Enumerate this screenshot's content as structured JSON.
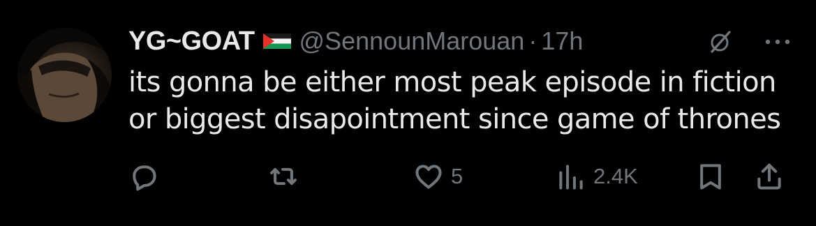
{
  "tweet": {
    "display_name": "YG~GOAT",
    "flag_icon": "palestine-flag-icon",
    "handle": "@SennounMarouan",
    "separator": "·",
    "time": "17h",
    "lines": [
      "its gonna be either most peak episode in fiction",
      "or biggest disapointment since game of thrones"
    ]
  },
  "actions": {
    "reply": {
      "icon": "reply-icon",
      "count": ""
    },
    "retweet": {
      "icon": "retweet-icon",
      "count": ""
    },
    "like": {
      "icon": "heart-icon",
      "count": "5"
    },
    "views": {
      "icon": "views-icon",
      "count": "2.4K"
    },
    "bookmark": {
      "icon": "bookmark-icon"
    },
    "share": {
      "icon": "share-icon"
    }
  },
  "colors": {
    "background": "#000000",
    "text": "#e7e9ea",
    "muted": "#71767b"
  }
}
